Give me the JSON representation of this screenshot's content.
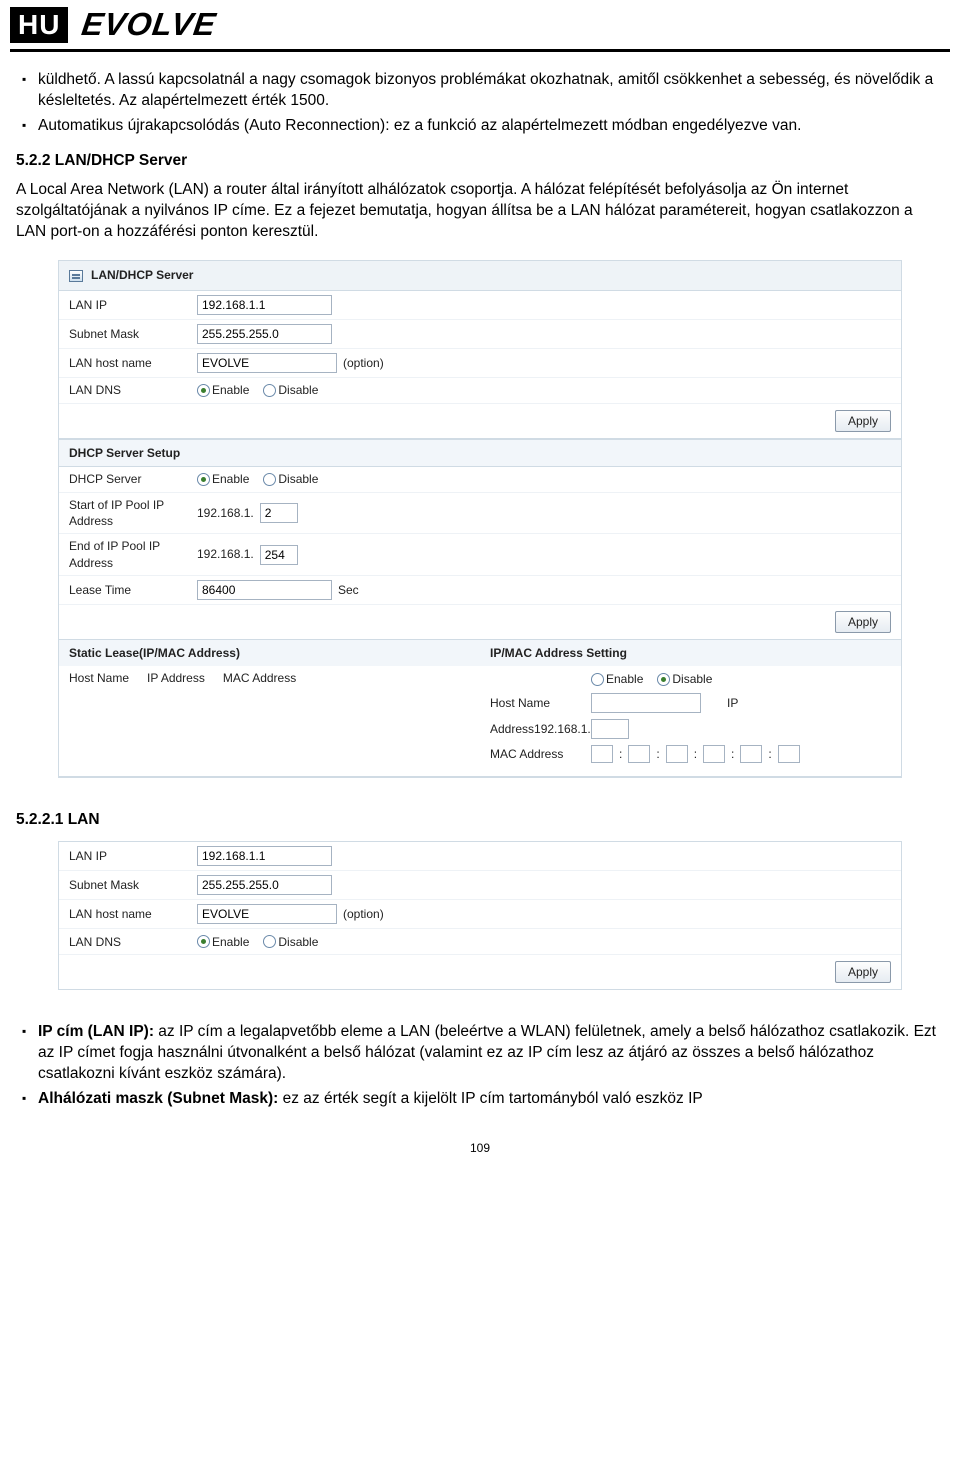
{
  "header": {
    "lang_badge": "HU",
    "brand": "EVOLVE"
  },
  "intro_bullets": [
    "küldhető. A lassú kapcsolatnál a nagy csomagok bizonyos problémákat okozhatnak, amitől csökkenhet a sebesség, és növelődik a késleltetés. Az alapértelmezett érték 1500.",
    "Automatikus újrakapcsolódás (Auto Reconnection): ez a funkció az alapértelmezett módban engedélyezve van."
  ],
  "section522_title": "5.2.2 LAN/DHCP Server",
  "section522_text": "A Local Area Network (LAN) a router által irányított alhálózatok csoportja. A hálózat felépítését befolyásolja az Ön internet szolgáltatójának a nyilvános IP címe. Ez a fejezet bemutatja, hogyan állítsa be a LAN hálózat paramétereit, hogyan csatlakozzon a LAN port-on a hozzáférési ponton keresztül.",
  "panel": {
    "title": "LAN/DHCP Server",
    "lan": {
      "ip_label": "LAN IP",
      "ip_value": "192.168.1.1",
      "mask_label": "Subnet Mask",
      "mask_value": "255.255.255.0",
      "host_label": "LAN host name",
      "host_value": "EVOLVE",
      "host_option": "(option)",
      "dns_label": "LAN DNS",
      "enable": "Enable",
      "disable": "Disable"
    },
    "dhcp": {
      "header": "DHCP Server Setup",
      "server_label": "DHCP Server",
      "start_label": "Start of IP Pool IP Address",
      "start_prefix": "192.168.1.",
      "start_value": "2",
      "end_label": "End of IP Pool IP Address",
      "end_prefix": "192.168.1.",
      "end_value": "254",
      "lease_label": "Lease Time",
      "lease_value": "86400",
      "lease_unit": "Sec"
    },
    "apply": "Apply",
    "static_lease": {
      "header": "Static Lease(IP/MAC Address)",
      "col_host": "Host Name",
      "col_ip": "IP Address",
      "col_mac": "MAC Address"
    },
    "ipmac": {
      "header": "IP/MAC Address Setting",
      "enable": "Enable",
      "disable": "Disable",
      "host_label": "Host Name",
      "ip_suffix": "IP",
      "addr_label": "Address",
      "addr_prefix": "192.168.1.",
      "mac_label": "MAC Address"
    }
  },
  "section5221_title": "5.2.2.1 LAN",
  "end_bullets": {
    "b1_bold": "IP cím (LAN IP):",
    "b1_text": " az IP cím a legalapvetőbb eleme a LAN (beleértve a WLAN) felületnek, amely a belső hálózathoz csatlakozik. Ezt az IP címet fogja használni útvonalként a belső hálózat (valamint ez az IP cím lesz az átjáró az összes a belső hálózathoz csatlakozni kívánt eszköz számára).",
    "b2_bold": "Alhálózati maszk (Subnet Mask):",
    "b2_text": " ez az érték segít a kijelölt IP cím tartományból való eszköz IP"
  },
  "page_number": "109"
}
